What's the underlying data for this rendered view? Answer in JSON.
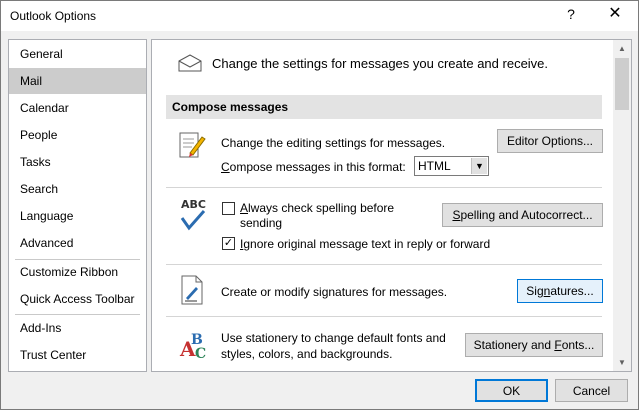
{
  "window": {
    "title": "Outlook Options",
    "help": "?",
    "close": "✕"
  },
  "nav": {
    "items": [
      {
        "label": "General"
      },
      {
        "label": "Mail"
      },
      {
        "label": "Calendar"
      },
      {
        "label": "People"
      },
      {
        "label": "Tasks"
      },
      {
        "label": "Search"
      },
      {
        "label": "Language"
      },
      {
        "label": "Advanced"
      },
      {
        "label": "Customize Ribbon"
      },
      {
        "label": "Quick Access Toolbar"
      },
      {
        "label": "Add-Ins"
      },
      {
        "label": "Trust Center"
      }
    ],
    "selected": "Mail"
  },
  "content": {
    "intro": "Change the settings for messages you create and receive.",
    "section_title": "Compose messages",
    "editing": {
      "text": "Change the editing settings for messages.",
      "button": "Editor Options...",
      "format_label_u": "C",
      "format_label_rest": "ompose messages in this format:",
      "format_value": "HTML"
    },
    "spelling": {
      "always_u": "A",
      "always_rest": "lways check spelling before",
      "always_line2": "sending",
      "always_checked": false,
      "ignore_u": "I",
      "ignore_rest": "gnore original message text in reply or forward",
      "ignore_checked": true,
      "button_u": "S",
      "button_rest": "pelling and Autocorrect..."
    },
    "signatures": {
      "text": "Create or modify signatures for messages.",
      "button_pre": "Sig",
      "button_u": "n",
      "button_post": "atures..."
    },
    "stationery": {
      "line1": "Use stationery to change default fonts and",
      "line2": "styles, colors, and backgrounds.",
      "button_pre": "Stationery and ",
      "button_u": "F",
      "button_post": "onts..."
    }
  },
  "footer": {
    "ok": "OK",
    "cancel": "Cancel"
  },
  "colors": {
    "accent": "#0078d7",
    "selected_nav": "#cccccc",
    "section_bg": "#e3e3e3"
  }
}
